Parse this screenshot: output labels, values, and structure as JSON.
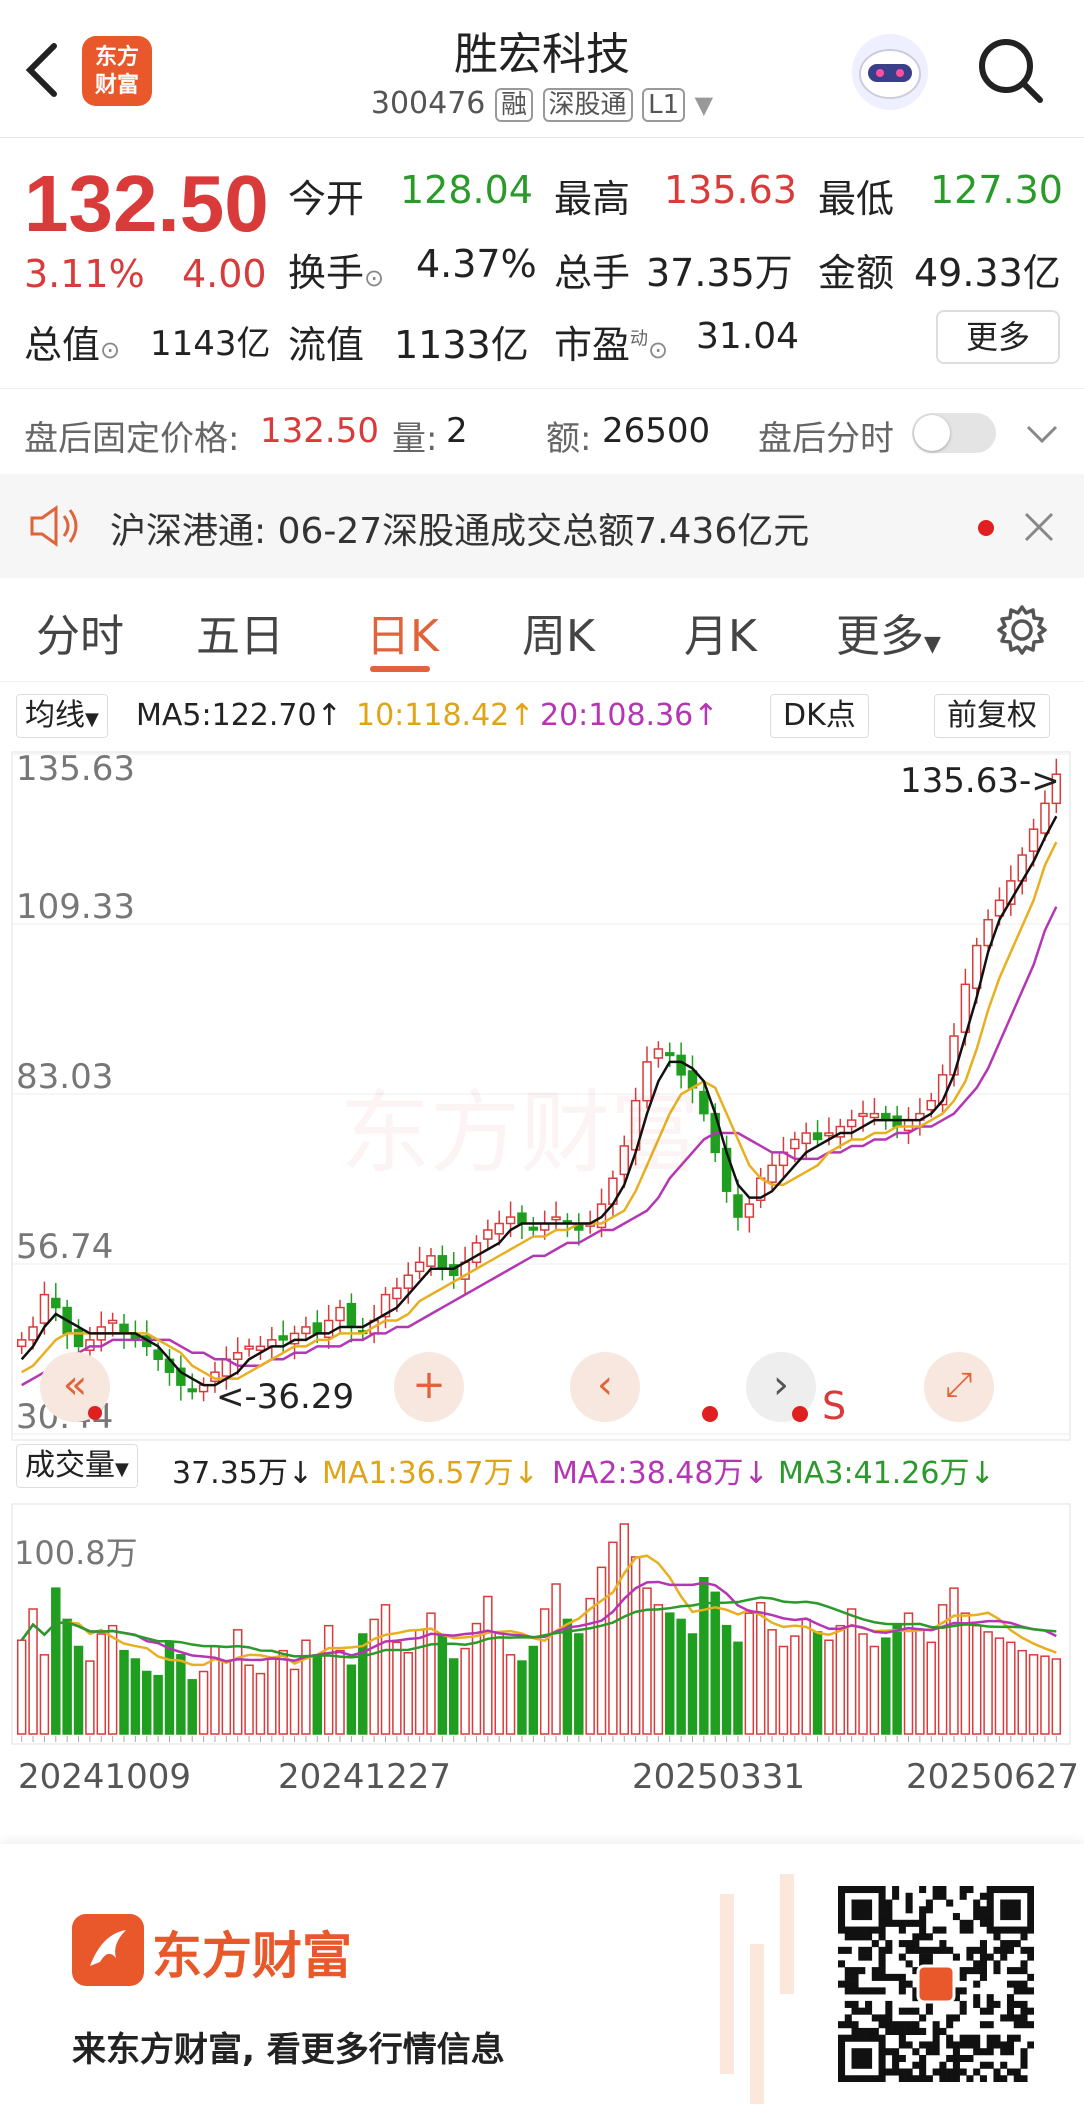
{
  "header": {
    "title": "胜宏科技",
    "code": "300476",
    "tags": [
      "融",
      "深股通",
      "L1"
    ],
    "logo_text": "东方\n财富"
  },
  "quote": {
    "price": "132.50",
    "change_pct": "3.11%",
    "change": "4.00",
    "fields": [
      {
        "label": "今开",
        "value": "128.04",
        "color": "#2a9a2a"
      },
      {
        "label": "最高",
        "value": "135.63",
        "color": "#d93a3a"
      },
      {
        "label": "最低",
        "value": "127.30",
        "color": "#2a9a2a"
      },
      {
        "label": "换手",
        "value": "4.37%",
        "color": "#222"
      },
      {
        "label": "总手",
        "value": "37.35万",
        "color": "#222"
      },
      {
        "label": "金额",
        "value": "49.33亿",
        "color": "#222"
      },
      {
        "label": "总值",
        "value": "1143亿",
        "color": "#222"
      },
      {
        "label": "流值",
        "value": "1133亿",
        "color": "#222"
      },
      {
        "label": "市盈",
        "value": "31.04",
        "color": "#222"
      }
    ],
    "pe_superscript": "动",
    "more_label": "更多"
  },
  "afterhours": {
    "price_label": "盘后固定价格:",
    "price_value": "132.50",
    "vol_label": "量:",
    "vol_value": "2",
    "amt_label": "额:",
    "amt_value": "26500",
    "toggle_label": "盘后分时",
    "toggle_on": false
  },
  "notice": {
    "text": "沪深港通: 06-27深股通成交总额7.436亿元"
  },
  "tabs": {
    "items": [
      "分时",
      "五日",
      "日K",
      "周K",
      "月K",
      "更多"
    ],
    "active": "日K"
  },
  "indicators": {
    "ma_selector": "均线",
    "ma5": "MA5:122.70↑",
    "ma10": "10:118.42↑",
    "ma20": "20:108.36↑",
    "dk_label": "DK点",
    "adjust_label": "前复权",
    "vol_selector": "成交量",
    "vol_value": "37.35万↓",
    "vma1": "MA1:36.57万↓",
    "vma2": "MA2:38.48万↓",
    "vma3": "MA3:41.26万↓"
  },
  "chart_data": {
    "type": "candlestick",
    "y_ticks": [
      "135.63",
      "109.33",
      "83.03",
      "56.74",
      "30.44"
    ],
    "ylim": [
      30.44,
      135.63
    ],
    "max_annotation": "135.63->",
    "min_annotation": "<-36.29",
    "volume_max_label": "100.8万",
    "x_dates": [
      "20241009",
      "20241227",
      "20250331",
      "20250627"
    ],
    "signal_label": "S",
    "close_series": [
      45,
      47,
      52,
      50,
      46,
      44,
      45,
      47,
      48,
      46,
      45,
      44,
      42,
      40,
      38,
      37,
      38,
      40,
      42,
      43,
      44,
      44,
      45,
      45,
      46,
      47,
      46,
      48,
      50,
      47,
      46,
      48,
      52,
      53,
      55,
      57,
      58,
      56,
      55,
      57,
      60,
      62,
      63,
      64,
      63,
      62,
      63,
      64,
      63,
      62,
      63,
      66,
      70,
      75,
      82,
      88,
      90,
      89,
      86,
      84,
      80,
      74,
      68,
      64,
      66,
      70,
      72,
      74,
      76,
      77,
      76,
      77,
      78,
      79,
      80,
      80,
      79,
      78,
      79,
      80,
      82,
      86,
      92,
      100,
      106,
      110,
      113,
      116,
      120,
      124,
      128,
      132.5
    ],
    "ma5_series": [
      42,
      44,
      47,
      49,
      48,
      47,
      46,
      46,
      46,
      46,
      46,
      45,
      44,
      42,
      40,
      39,
      38,
      38,
      39,
      40,
      42,
      43,
      44,
      44,
      45,
      45,
      46,
      46,
      47,
      47,
      47,
      48,
      49,
      50,
      52,
      54,
      56,
      56,
      56,
      57,
      58,
      59,
      60,
      62,
      63,
      63,
      63,
      63,
      63,
      63,
      63,
      64,
      66,
      69,
      74,
      80,
      85,
      88,
      88,
      87,
      85,
      80,
      74,
      69,
      67,
      67,
      68,
      70,
      72,
      74,
      75,
      76,
      77,
      77,
      78,
      79,
      79,
      79,
      79,
      79,
      80,
      82,
      86,
      92,
      98,
      105,
      110,
      113,
      116,
      119,
      122.7,
      126
    ],
    "ma10_series": [
      40,
      41,
      43,
      45,
      46,
      46,
      46,
      46,
      46,
      46,
      46,
      46,
      45,
      44,
      43,
      41,
      40,
      39,
      39,
      39,
      40,
      41,
      42,
      43,
      44,
      44,
      45,
      45,
      46,
      46,
      46,
      47,
      48,
      48,
      49,
      51,
      52,
      53,
      54,
      55,
      56,
      57,
      58,
      59,
      60,
      61,
      61,
      62,
      62,
      63,
      63,
      63,
      64,
      65,
      68,
      72,
      76,
      80,
      83,
      84,
      85,
      84,
      80,
      76,
      72,
      70,
      69,
      69,
      70,
      71,
      72,
      74,
      75,
      76,
      76,
      77,
      77,
      78,
      78,
      78,
      79,
      80,
      82,
      85,
      90,
      96,
      101,
      105,
      109,
      113,
      118.42,
      122
    ],
    "ma20_series": [
      38,
      39,
      40,
      41,
      42,
      43,
      44,
      44,
      45,
      45,
      45,
      45,
      45,
      45,
      44,
      43,
      43,
      42,
      42,
      41,
      41,
      41,
      42,
      42,
      43,
      43,
      44,
      44,
      44,
      45,
      45,
      46,
      46,
      47,
      47,
      48,
      49,
      50,
      51,
      52,
      53,
      54,
      55,
      56,
      57,
      58,
      58,
      59,
      60,
      60,
      61,
      62,
      62,
      63,
      64,
      65,
      67,
      70,
      72,
      74,
      76,
      77,
      77,
      77,
      76,
      75,
      74,
      74,
      73,
      73,
      73,
      74,
      74,
      75,
      75,
      76,
      76,
      77,
      77,
      78,
      78,
      79,
      80,
      82,
      84,
      87,
      91,
      95,
      99,
      103,
      108.36,
      112
    ],
    "volume_series": [
      45,
      60,
      38,
      70,
      55,
      42,
      35,
      48,
      52,
      40,
      36,
      30,
      28,
      44,
      38,
      26,
      30,
      42,
      35,
      50,
      33,
      29,
      36,
      40,
      31,
      45,
      38,
      52,
      40,
      33,
      48,
      55,
      62,
      44,
      39,
      50,
      58,
      47,
      36,
      41,
      53,
      66,
      49,
      38,
      35,
      42,
      60,
      72,
      55,
      48,
      65,
      80,
      92,
      100.8,
      85,
      70,
      62,
      58,
      55,
      48,
      75,
      68,
      52,
      44,
      58,
      63,
      50,
      42,
      47,
      55,
      49,
      45,
      52,
      60,
      48,
      42,
      46,
      53,
      58,
      50,
      44,
      62,
      70,
      58,
      52,
      49,
      46,
      44,
      40,
      38,
      37.35,
      36
    ],
    "colors": {
      "up": "#d93a3a",
      "down": "#1f9e1f",
      "ma5": "#111111",
      "ma10": "#e8b020",
      "ma20": "#b436b4"
    }
  },
  "footer": {
    "brand": "东方财富",
    "slogan": "来东方财富, 看更多行情信息"
  }
}
